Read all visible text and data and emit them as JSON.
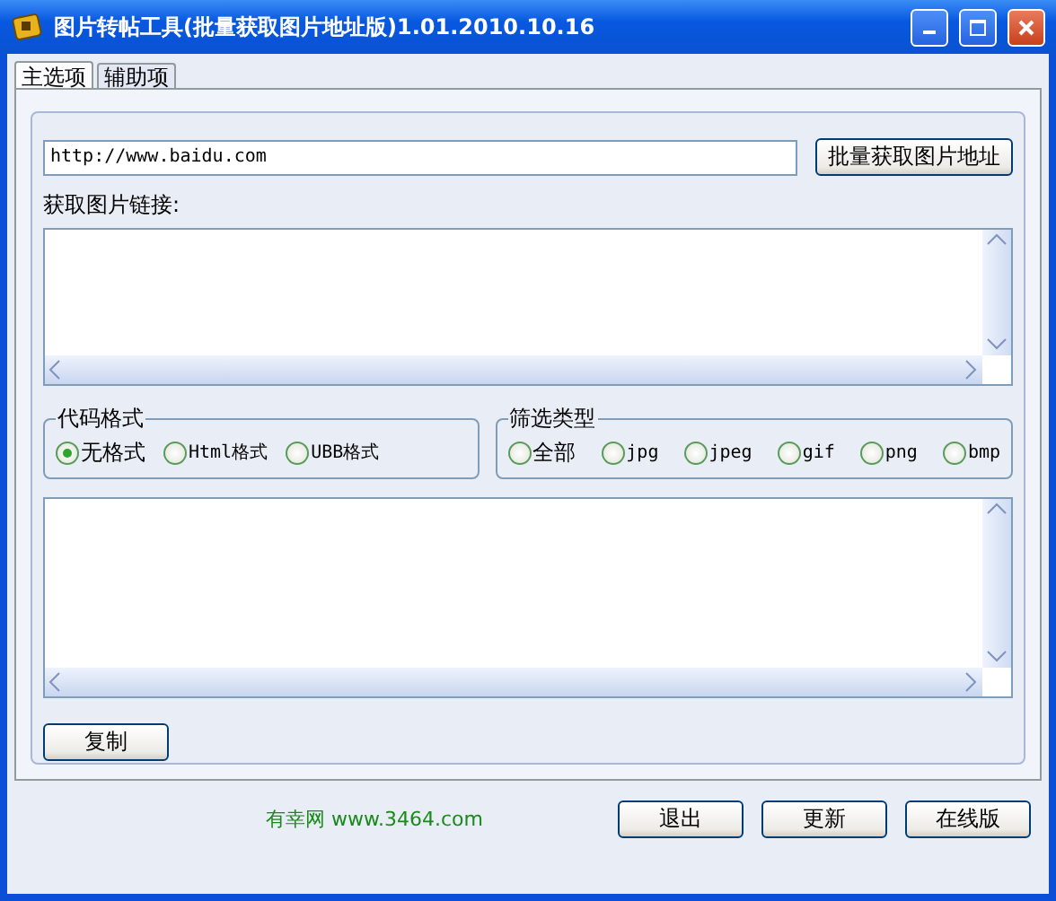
{
  "window": {
    "title": "图片转帖工具(批量获取图片地址版)1.01.2010.10.16"
  },
  "tabs": [
    {
      "label": "主选项",
      "selected": true
    },
    {
      "label": "辅助项",
      "selected": false
    }
  ],
  "url_field": {
    "value": "http://www.baidu.com"
  },
  "fetch_button": "批量获取图片地址",
  "links_label": "获取图片链接:",
  "code_format": {
    "title": "代码格式",
    "options": [
      {
        "label": "无格式",
        "selected": true
      },
      {
        "label": "Html格式",
        "selected": false
      },
      {
        "label": "UBB格式",
        "selected": false
      }
    ]
  },
  "filter_type": {
    "title": "筛选类型",
    "options": [
      {
        "label": "全部",
        "selected": false
      },
      {
        "label": "jpg",
        "selected": false
      },
      {
        "label": "jpeg",
        "selected": false
      },
      {
        "label": "gif",
        "selected": false
      },
      {
        "label": "png",
        "selected": false
      },
      {
        "label": "bmp",
        "selected": false
      }
    ]
  },
  "copy_button": "复制",
  "footer_text": "有幸网 www.3464.com",
  "buttons": [
    "退出",
    "更新",
    "在线版"
  ]
}
